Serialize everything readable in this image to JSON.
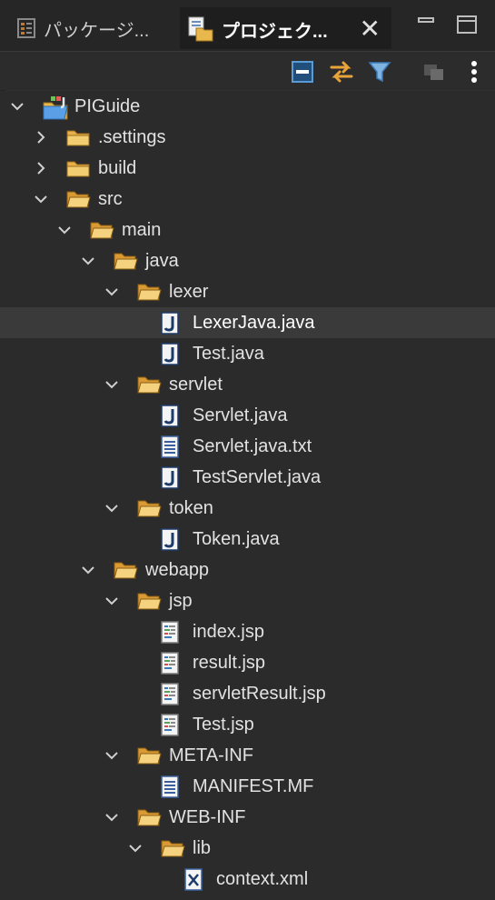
{
  "tabs": [
    {
      "label": "パッケージ...",
      "icon": "package-explorer-icon",
      "active": false
    },
    {
      "label": "プロジェク...",
      "icon": "project-explorer-icon",
      "active": true
    }
  ],
  "toolbar": [
    {
      "icon": "collapse-all-icon"
    },
    {
      "icon": "link-with-editor-icon"
    },
    {
      "icon": "filter-icon"
    },
    {
      "icon": "working-sets-icon"
    },
    {
      "icon": "view-menu-icon"
    }
  ],
  "tree": [
    {
      "label": "PIGuide",
      "depth": 0,
      "twisty": "expanded",
      "icon": "project-icon"
    },
    {
      "label": ".settings",
      "depth": 1,
      "twisty": "collapsed",
      "icon": "folder-icon"
    },
    {
      "label": "build",
      "depth": 1,
      "twisty": "collapsed",
      "icon": "folder-icon"
    },
    {
      "label": "src",
      "depth": 1,
      "twisty": "expanded",
      "icon": "folder-open-icon"
    },
    {
      "label": "main",
      "depth": 2,
      "twisty": "expanded",
      "icon": "folder-open-icon"
    },
    {
      "label": "java",
      "depth": 3,
      "twisty": "expanded",
      "icon": "folder-open-icon"
    },
    {
      "label": "lexer",
      "depth": 4,
      "twisty": "expanded",
      "icon": "folder-open-icon"
    },
    {
      "label": "LexerJava.java",
      "depth": 5,
      "twisty": "none",
      "icon": "java-file-icon",
      "selected": true
    },
    {
      "label": "Test.java",
      "depth": 5,
      "twisty": "none",
      "icon": "java-file-icon"
    },
    {
      "label": "servlet",
      "depth": 4,
      "twisty": "expanded",
      "icon": "folder-open-icon"
    },
    {
      "label": "Servlet.java",
      "depth": 5,
      "twisty": "none",
      "icon": "java-file-icon"
    },
    {
      "label": "Servlet.java.txt",
      "depth": 5,
      "twisty": "none",
      "icon": "text-file-icon"
    },
    {
      "label": "TestServlet.java",
      "depth": 5,
      "twisty": "none",
      "icon": "java-file-icon"
    },
    {
      "label": "token",
      "depth": 4,
      "twisty": "expanded",
      "icon": "folder-open-icon"
    },
    {
      "label": "Token.java",
      "depth": 5,
      "twisty": "none",
      "icon": "java-file-icon"
    },
    {
      "label": "webapp",
      "depth": 3,
      "twisty": "expanded",
      "icon": "folder-open-icon"
    },
    {
      "label": "jsp",
      "depth": 4,
      "twisty": "expanded",
      "icon": "folder-open-icon"
    },
    {
      "label": "index.jsp",
      "depth": 5,
      "twisty": "none",
      "icon": "jsp-file-icon"
    },
    {
      "label": "result.jsp",
      "depth": 5,
      "twisty": "none",
      "icon": "jsp-file-icon"
    },
    {
      "label": "servletResult.jsp",
      "depth": 5,
      "twisty": "none",
      "icon": "jsp-file-icon"
    },
    {
      "label": "Test.jsp",
      "depth": 5,
      "twisty": "none",
      "icon": "jsp-file-icon"
    },
    {
      "label": "META-INF",
      "depth": 4,
      "twisty": "expanded",
      "icon": "folder-open-icon"
    },
    {
      "label": "MANIFEST.MF",
      "depth": 5,
      "twisty": "none",
      "icon": "text-file-icon"
    },
    {
      "label": "WEB-INF",
      "depth": 4,
      "twisty": "expanded",
      "icon": "folder-open-icon"
    },
    {
      "label": "lib",
      "depth": 5,
      "twisty": "expanded",
      "icon": "folder-open-icon"
    },
    {
      "label": "context.xml",
      "depth": 6,
      "twisty": "none",
      "icon": "xml-file-icon"
    }
  ]
}
